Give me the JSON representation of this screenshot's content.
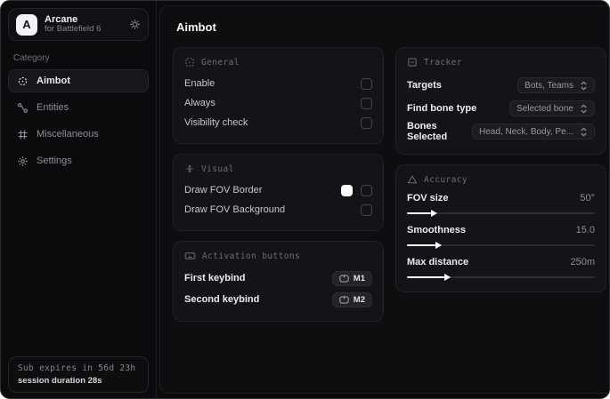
{
  "app": {
    "logo_letter": "A",
    "name": "Arcane",
    "subtitle": "for Battlefield 6"
  },
  "sidebar": {
    "category_label": "Category",
    "items": [
      {
        "label": "Aimbot",
        "icon": "crosshair-icon",
        "active": true
      },
      {
        "label": "Entities",
        "icon": "entities-icon",
        "active": false
      },
      {
        "label": "Miscellaneous",
        "icon": "grid-icon",
        "active": false
      },
      {
        "label": "Settings",
        "icon": "gear-icon",
        "active": false
      }
    ],
    "footer": {
      "line1": "Sub expires in 56d 23h",
      "line2": "session duration 28s"
    }
  },
  "main": {
    "title": "Aimbot",
    "general": {
      "title": "General",
      "icon": "grid-dashed-icon",
      "rows": [
        {
          "label": "Enable",
          "checked": false
        },
        {
          "label": "Always",
          "checked": false
        },
        {
          "label": "Visibility check",
          "checked": false
        }
      ]
    },
    "visual": {
      "title": "Visual",
      "icon": "move-icon",
      "rows": [
        {
          "label": "Draw FOV Border",
          "swatch": "#ffffff",
          "checked": false
        },
        {
          "label": "Draw FOV Background",
          "checked": false
        }
      ]
    },
    "activation": {
      "title": "Activation buttons",
      "icon": "keyboard-icon",
      "rows": [
        {
          "label": "First keybind",
          "key": "M1"
        },
        {
          "label": "Second keybind",
          "key": "M2"
        }
      ]
    },
    "tracker": {
      "title": "Tracker",
      "icon": "box-minus-icon",
      "rows": [
        {
          "label": "Targets",
          "value": "Bots, Teams"
        },
        {
          "label": "Find bone type",
          "value": "Selected bone"
        },
        {
          "label": "Bones Selected",
          "value": "Head, Neck, Body, Pe..."
        }
      ]
    },
    "accuracy": {
      "title": "Accuracy",
      "icon": "triangle-icon",
      "sliders": [
        {
          "label": "FOV size",
          "value": "50°",
          "percent": 13
        },
        {
          "label": "Smoothness",
          "value": "15.0",
          "percent": 15
        },
        {
          "label": "Max distance",
          "value": "250m",
          "percent": 20
        }
      ]
    }
  },
  "colors": {
    "accent": "#ffffff",
    "window_bg": "#0a0b0d",
    "card_bg": "#131417"
  }
}
